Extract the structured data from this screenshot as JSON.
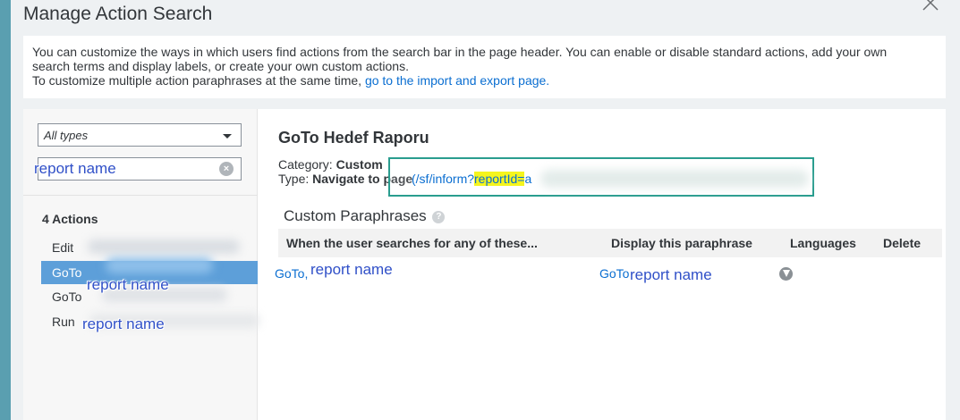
{
  "dialog": {
    "title": "Manage Action Search",
    "close_icon": "close-icon"
  },
  "info": {
    "line1": "You can customize the ways in which users find actions from the search bar in the page header. You can enable or disable standard actions, add your own",
    "line2": "search terms and display labels, or create your own custom actions.",
    "line3_prefix": "To customize multiple action paraphrases at the same time,",
    "line3_link": "go to the import and export page."
  },
  "sidebar": {
    "type_filter_value": "All types",
    "search_value": "report name",
    "actions_count": "4 Actions",
    "items": [
      {
        "label": "Edit"
      },
      {
        "label": "GoTo"
      },
      {
        "label": "GoTo"
      },
      {
        "label": "Run"
      }
    ],
    "annotations": {
      "selected_item": "report name",
      "run_item": "report name"
    }
  },
  "detail": {
    "title": "GoTo Hedef Raporu",
    "category_label": "Category:",
    "category_value": "Custom",
    "type_label": "Type:",
    "type_value": "Navigate to page",
    "url_prefix": "(/sf/inform?",
    "url_highlight": "reportId=",
    "url_suffix": "a",
    "paraphrases_title": "Custom Paraphrases",
    "table": {
      "headers": [
        "When the user searches for any of these...",
        "Display this paraphrase",
        "Languages",
        "Delete"
      ],
      "row": {
        "search_terms": "GoTo,",
        "search_annotation": "report name",
        "display": "GoTo",
        "display_annotation": "report name",
        "language_icon": "language-marker-icon"
      }
    }
  },
  "colors": {
    "selected_row": "#5d9fd9",
    "link": "#0a6ed1",
    "highlight": "#f5f51e",
    "highlight_border": "#2a9d8f",
    "annotation": "#3050c8"
  }
}
